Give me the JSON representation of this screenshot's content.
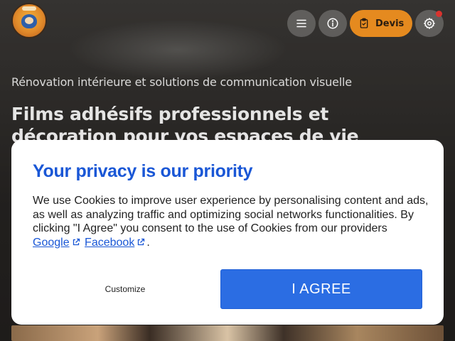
{
  "header": {
    "logo_icon": "bear-mascot-logo",
    "menu_icon": "hamburger-menu-icon",
    "info_icon": "info-icon",
    "devis_label": "Devis",
    "devis_icon": "clipboard-check-icon",
    "settings_icon": "gear-icon",
    "notification_color": "#d9332e"
  },
  "hero": {
    "subtitle": "Rénovation intérieure et solutions de communication visuelle",
    "headline": "Films adhésifs professionnels et décoration pour vos espaces de vie"
  },
  "consent": {
    "title": "Your privacy is our priority",
    "body_text": "We use Cookies to improve user experience by personalising content and ads, as well as analyzing traffic and optimizing social networks functionalities. By clicking \"I Agree\" you consent to the use of Cookies from our providers",
    "providers": [
      "Google",
      "Facebook"
    ],
    "trailing": ".",
    "customize_label": "Customize",
    "agree_label": "I AGREE"
  },
  "colors": {
    "accent": "#e58a1f",
    "link": "#1a57d6",
    "agree_button": "#2b6de3"
  }
}
